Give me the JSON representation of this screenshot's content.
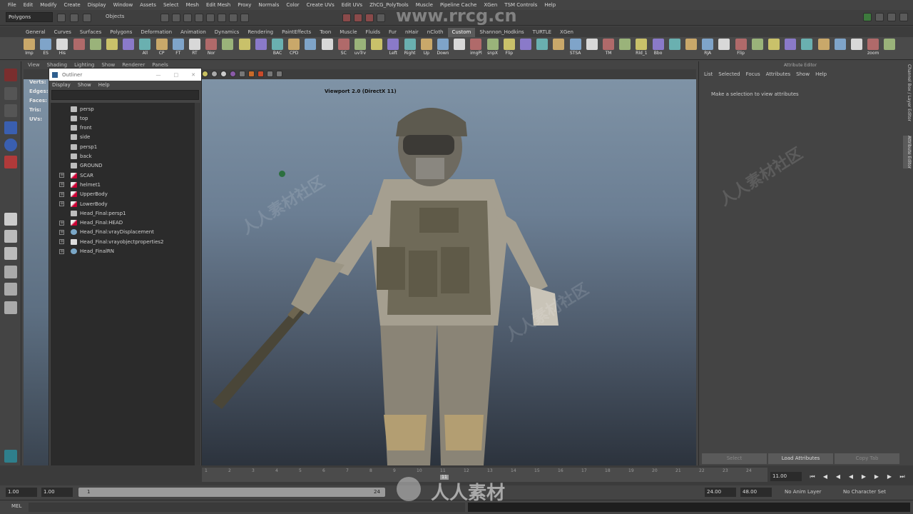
{
  "menubar": [
    "File",
    "Edit",
    "Modify",
    "Create",
    "Display",
    "Window",
    "Assets",
    "Select",
    "Mesh",
    "Edit Mesh",
    "Proxy",
    "Normals",
    "Color",
    "Create UVs",
    "Edit UVs",
    "ZhCG_PolyTools",
    "Muscle",
    "Pipeline Cache",
    "XGen",
    "TSM Controls",
    "Help"
  ],
  "statusline": {
    "mode": "Polygons",
    "objects_label": "Objects"
  },
  "shelf_tabs": [
    "General",
    "Curves",
    "Surfaces",
    "Polygons",
    "Deformation",
    "Animation",
    "Dynamics",
    "Rendering",
    "PaintEffects",
    "Toon",
    "Muscle",
    "Fluids",
    "Fur",
    "nHair",
    "nCloth",
    "Custom",
    "Shannon_Hodkins",
    "TURTLE",
    "XGen"
  ],
  "active_shelf_tab": "Custom",
  "shelf_buttons": [
    "Imp",
    "ES",
    "His",
    "",
    "",
    "",
    "",
    "All",
    "CP",
    "FT",
    "RT",
    "Nor",
    "",
    "",
    "",
    "BAC",
    "CPD",
    "",
    "",
    "SC",
    "uvTrv",
    "",
    "Left",
    "Right",
    "Up",
    "Down",
    "",
    "imgPl",
    "snpX",
    "Flip",
    "",
    "",
    "",
    "STSA",
    "",
    "TM",
    "",
    "Rld_1",
    "Bbo",
    "",
    "",
    "RJA",
    "",
    "Flip",
    "",
    "",
    "",
    "",
    "",
    "",
    "",
    "zoom",
    ""
  ],
  "viewport_menu": [
    "View",
    "Shading",
    "Lighting",
    "Show",
    "Renderer",
    "Panels"
  ],
  "viewport_label": "Viewport 2.0 (DirectX 11)",
  "hud": [
    {
      "label": "Verts:"
    },
    {
      "label": "Edges:"
    },
    {
      "label": "Faces:"
    },
    {
      "label": "Tris:"
    },
    {
      "label": "UVs:"
    }
  ],
  "outliner": {
    "title": "Outliner",
    "menus": [
      "Display",
      "Show",
      "Help"
    ],
    "items": [
      {
        "name": "persp",
        "icon": "camera-icon",
        "expand": false
      },
      {
        "name": "top",
        "icon": "camera-icon",
        "expand": false
      },
      {
        "name": "front",
        "icon": "camera-icon",
        "expand": false
      },
      {
        "name": "side",
        "icon": "camera-icon",
        "expand": false
      },
      {
        "name": "persp1",
        "icon": "camera-icon",
        "expand": false
      },
      {
        "name": "back",
        "icon": "camera-icon",
        "expand": false
      },
      {
        "name": "GROUND",
        "icon": "camera-icon",
        "expand": false
      },
      {
        "name": "SCAR",
        "icon": "mesh-icon",
        "expand": true
      },
      {
        "name": "helmet1",
        "icon": "mesh-icon",
        "expand": true
      },
      {
        "name": "UpperBody",
        "icon": "mesh-icon",
        "expand": true
      },
      {
        "name": "LowerBody",
        "icon": "mesh-icon",
        "expand": true
      },
      {
        "name": "Head_Final:persp1",
        "icon": "camera-icon",
        "expand": false
      },
      {
        "name": "Head_Final:HEAD",
        "icon": "mesh-icon",
        "expand": true
      },
      {
        "name": "Head_Final:vrayDisplacement",
        "icon": "sphere-icon",
        "expand": true
      },
      {
        "name": "Head_Final:vrayobjectproperties2",
        "icon": "group-icon",
        "expand": true
      },
      {
        "name": "Head_FinalRN",
        "icon": "reference-icon",
        "expand": true
      }
    ]
  },
  "attribute_editor": {
    "title": "Attribute Editor",
    "menus": [
      "List",
      "Selected",
      "Focus",
      "Attributes",
      "Show",
      "Help"
    ],
    "message": "Make a selection to view attributes",
    "buttons": [
      "Select",
      "Load Attributes",
      "Copy Tab"
    ]
  },
  "side_tabs": [
    "Channel Box / Layer Editor",
    "Attribute Editor"
  ],
  "timeline": {
    "ticks": [
      "1",
      "2",
      "3",
      "4",
      "5",
      "6",
      "7",
      "8",
      "9",
      "10",
      "11",
      "12",
      "13",
      "14",
      "15",
      "16",
      "17",
      "18",
      "19",
      "20",
      "21",
      "22",
      "23",
      "24"
    ],
    "current_frame": "11",
    "current_time": "11.00"
  },
  "range": {
    "start": "1.00",
    "start2": "1.00",
    "range_start": "1",
    "range_end": "24",
    "end": "24.00",
    "end2": "48.00",
    "anim_layer": "No Anim Layer",
    "char_set": "No Character Set"
  },
  "command": {
    "label": "MEL"
  },
  "watermark_top": "www.rrcg.cn",
  "watermark_bottom": "人人素材",
  "watermark_tile": "人人素材社区",
  "colors": {
    "accent": "#5a5a5a",
    "viewport_top": "#7f93a6",
    "viewport_bottom": "#2c333d"
  }
}
